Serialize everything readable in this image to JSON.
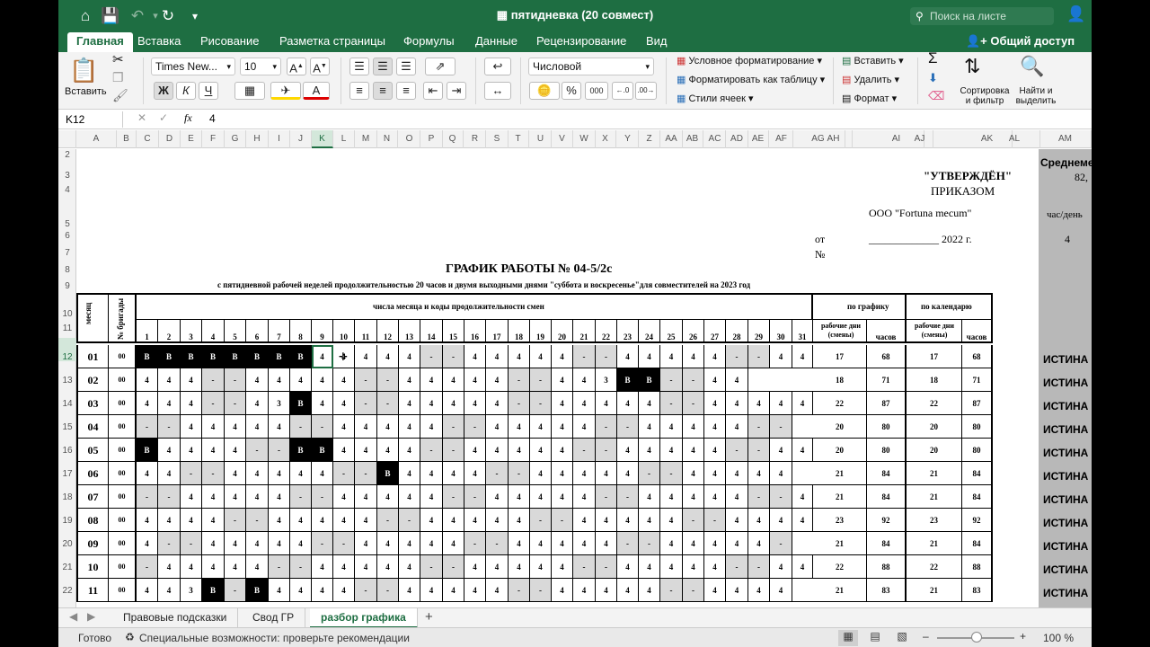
{
  "title": "пятидневка (20 совмест)",
  "search_placeholder": "Поиск на листе",
  "tabs": [
    "Главная",
    "Вставка",
    "Рисование",
    "Разметка страницы",
    "Формулы",
    "Данные",
    "Рецензирование",
    "Вид"
  ],
  "share": "Общий доступ",
  "ribbon": {
    "paste": "Вставить",
    "font": "Times New...",
    "size": "10",
    "numfmt": "Числовой",
    "cond": "Условное форматирование",
    "fmt_table": "Форматировать как таблицу",
    "styles": "Стили ячеек",
    "insert": "Вставить",
    "delete": "Удалить",
    "format": "Формат",
    "sort": "Сортировка и фильтр",
    "find": "Найти и выделить",
    "bold": "Ж",
    "italic": "К",
    "underline": "Ч",
    "percent": "%",
    "thousands": "000"
  },
  "formula": {
    "cell": "K12",
    "fx": "fx",
    "value": "4"
  },
  "columns": [
    "A",
    "B",
    "C",
    "D",
    "E",
    "F",
    "G",
    "H",
    "I",
    "J",
    "K",
    "L",
    "M",
    "N",
    "O",
    "P",
    "Q",
    "R",
    "S",
    "T",
    "U",
    "V",
    "W",
    "X",
    "Y",
    "Z",
    "AA",
    "AB",
    "AC",
    "AD",
    "AE",
    "AF",
    "AG",
    "AH",
    "AI",
    "AJ",
    "AK",
    "AL",
    "AM"
  ],
  "rows": [
    "2",
    "3",
    "4",
    "5",
    "6",
    "7",
    "8",
    "9",
    "10",
    "11",
    "12",
    "13",
    "14",
    "15",
    "16",
    "17",
    "18",
    "19",
    "20",
    "21",
    "22"
  ],
  "sheet": {
    "approved": "\"УТВЕРЖДЁН\"",
    "order": "ПРИКАЗОМ",
    "org": "ООО \"Fortuna mecum\"",
    "from": "от",
    "date": "_____________ 2022 г.",
    "num": "№",
    "heading": "ГРАФИК РАБОТЫ № 04-5/2с",
    "subheading": "с пятидневной рабочей неделей продолжительностью 20 часов и двумя выходными днями \"суббота и воскресенье\"для совместителей на 2023 год",
    "hdr_month": "месяц",
    "hdr_brigade": "№ бригады",
    "hdr_days": "числа месяца и коды продолжительности смен",
    "hdr_sched": "по графику",
    "hdr_cal": "по календарю",
    "hdr_workdays": "рабочие дни (смены)",
    "hdr_hours": "часов",
    "am_top": "Среднеме",
    "am_val": "82,",
    "am_unit": "час/день",
    "am_num": "4",
    "truth": "ИСТИНА"
  },
  "months": [
    {
      "m": "01",
      "b": "00",
      "days": [
        "В",
        "В",
        "В",
        "В",
        "В",
        "В",
        "В",
        "В",
        "4",
        "4",
        "4",
        "4",
        "4",
        "-",
        "-",
        "4",
        "4",
        "4",
        "4",
        "4",
        "-",
        "-",
        "4",
        "4",
        "4",
        "4",
        "4",
        "-",
        "-",
        "4",
        "4"
      ],
      "wd": "17",
      "h": "68",
      "cwd": "17",
      "ch": "68"
    },
    {
      "m": "02",
      "b": "00",
      "days": [
        "4",
        "4",
        "4",
        "-",
        "-",
        "4",
        "4",
        "4",
        "4",
        "4",
        "-",
        "-",
        "4",
        "4",
        "4",
        "4",
        "4",
        "-",
        "-",
        "4",
        "4",
        "3",
        "В",
        "В",
        "-",
        "-",
        "4",
        "4",
        "",
        "",
        ""
      ],
      "wd": "18",
      "h": "71",
      "cwd": "18",
      "ch": "71"
    },
    {
      "m": "03",
      "b": "00",
      "days": [
        "4",
        "4",
        "4",
        "-",
        "-",
        "4",
        "3",
        "В",
        "4",
        "4",
        "-",
        "-",
        "4",
        "4",
        "4",
        "4",
        "4",
        "-",
        "-",
        "4",
        "4",
        "4",
        "4",
        "4",
        "-",
        "-",
        "4",
        "4",
        "4",
        "4",
        "4"
      ],
      "wd": "22",
      "h": "87",
      "cwd": "22",
      "ch": "87"
    },
    {
      "m": "04",
      "b": "00",
      "days": [
        "-",
        "-",
        "4",
        "4",
        "4",
        "4",
        "4",
        "-",
        "-",
        "4",
        "4",
        "4",
        "4",
        "4",
        "-",
        "-",
        "4",
        "4",
        "4",
        "4",
        "4",
        "-",
        "-",
        "4",
        "4",
        "4",
        "4",
        "4",
        "-",
        "-",
        ""
      ],
      "wd": "20",
      "h": "80",
      "cwd": "20",
      "ch": "80"
    },
    {
      "m": "05",
      "b": "00",
      "days": [
        "В",
        "4",
        "4",
        "4",
        "4",
        "-",
        "-",
        "В",
        "В",
        "4",
        "4",
        "4",
        "4",
        "-",
        "-",
        "4",
        "4",
        "4",
        "4",
        "4",
        "-",
        "-",
        "4",
        "4",
        "4",
        "4",
        "4",
        "-",
        "-",
        "4",
        "4"
      ],
      "wd": "20",
      "h": "80",
      "cwd": "20",
      "ch": "80"
    },
    {
      "m": "06",
      "b": "00",
      "days": [
        "4",
        "4",
        "-",
        "-",
        "4",
        "4",
        "4",
        "4",
        "4",
        "-",
        "-",
        "В",
        "4",
        "4",
        "4",
        "4",
        "-",
        "-",
        "4",
        "4",
        "4",
        "4",
        "4",
        "-",
        "-",
        "4",
        "4",
        "4",
        "4",
        "4",
        ""
      ],
      "wd": "21",
      "h": "84",
      "cwd": "21",
      "ch": "84"
    },
    {
      "m": "07",
      "b": "00",
      "days": [
        "-",
        "-",
        "4",
        "4",
        "4",
        "4",
        "4",
        "-",
        "-",
        "4",
        "4",
        "4",
        "4",
        "4",
        "-",
        "-",
        "4",
        "4",
        "4",
        "4",
        "4",
        "-",
        "-",
        "4",
        "4",
        "4",
        "4",
        "4",
        "-",
        "-",
        "4"
      ],
      "wd": "21",
      "h": "84",
      "cwd": "21",
      "ch": "84"
    },
    {
      "m": "08",
      "b": "00",
      "days": [
        "4",
        "4",
        "4",
        "4",
        "-",
        "-",
        "4",
        "4",
        "4",
        "4",
        "4",
        "-",
        "-",
        "4",
        "4",
        "4",
        "4",
        "4",
        "-",
        "-",
        "4",
        "4",
        "4",
        "4",
        "4",
        "-",
        "-",
        "4",
        "4",
        "4",
        "4"
      ],
      "wd": "23",
      "h": "92",
      "cwd": "23",
      "ch": "92"
    },
    {
      "m": "09",
      "b": "00",
      "days": [
        "4",
        "-",
        "-",
        "4",
        "4",
        "4",
        "4",
        "4",
        "-",
        "-",
        "4",
        "4",
        "4",
        "4",
        "4",
        "-",
        "-",
        "4",
        "4",
        "4",
        "4",
        "4",
        "-",
        "-",
        "4",
        "4",
        "4",
        "4",
        "4",
        "-",
        ""
      ],
      "wd": "21",
      "h": "84",
      "cwd": "21",
      "ch": "84"
    },
    {
      "m": "10",
      "b": "00",
      "days": [
        "-",
        "4",
        "4",
        "4",
        "4",
        "4",
        "-",
        "-",
        "4",
        "4",
        "4",
        "4",
        "4",
        "-",
        "-",
        "4",
        "4",
        "4",
        "4",
        "4",
        "-",
        "-",
        "4",
        "4",
        "4",
        "4",
        "4",
        "-",
        "-",
        "4",
        "4"
      ],
      "wd": "22",
      "h": "88",
      "cwd": "22",
      "ch": "88"
    },
    {
      "m": "11",
      "b": "00",
      "days": [
        "4",
        "4",
        "3",
        "В",
        "-",
        "В",
        "4",
        "4",
        "4",
        "4",
        "-",
        "-",
        "4",
        "4",
        "4",
        "4",
        "4",
        "-",
        "-",
        "4",
        "4",
        "4",
        "4",
        "4",
        "-",
        "-",
        "4",
        "4",
        "4",
        "4",
        ""
      ],
      "wd": "21",
      "h": "83",
      "cwd": "21",
      "ch": "83"
    }
  ],
  "sheet_tabs": [
    "Правовые подсказки",
    "Свод ГР",
    "разбор графика"
  ],
  "status": {
    "ready": "Готово",
    "access": "Специальные возможности: проверьте рекомендации",
    "zoom": "100 %"
  }
}
